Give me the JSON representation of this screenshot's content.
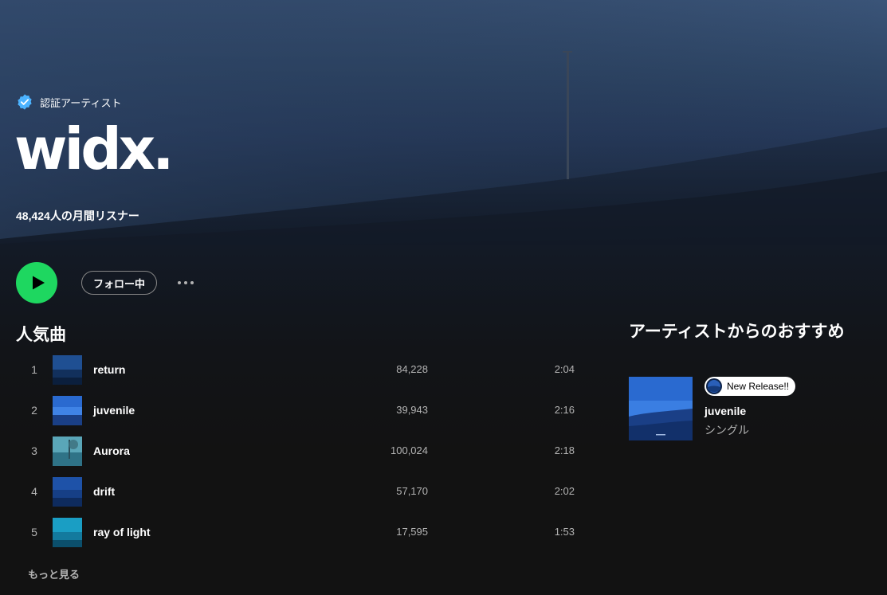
{
  "hero": {
    "verified_label": "認証アーティスト",
    "artist_name": "widx.",
    "monthly_listeners": "48,424人の月間リスナー"
  },
  "actions": {
    "follow_label": "フォロー中"
  },
  "popular": {
    "title": "人気曲",
    "tracks": [
      {
        "num": "1",
        "title": "return",
        "plays": "84,228",
        "duration": "2:04"
      },
      {
        "num": "2",
        "title": "juvenile",
        "plays": "39,943",
        "duration": "2:16"
      },
      {
        "num": "3",
        "title": "Aurora",
        "plays": "100,024",
        "duration": "2:18"
      },
      {
        "num": "4",
        "title": "drift",
        "plays": "57,170",
        "duration": "2:02"
      },
      {
        "num": "5",
        "title": "ray of light",
        "plays": "17,595",
        "duration": "1:53"
      }
    ],
    "see_more": "もっと見る"
  },
  "artist_pick": {
    "title": "アーティストからのおすすめ",
    "badge": "New Release!!",
    "name": "juvenile",
    "type": "シングル"
  },
  "colors": {
    "accent": "#1ed760",
    "background": "#121212",
    "verified": "#4cb3ff"
  }
}
